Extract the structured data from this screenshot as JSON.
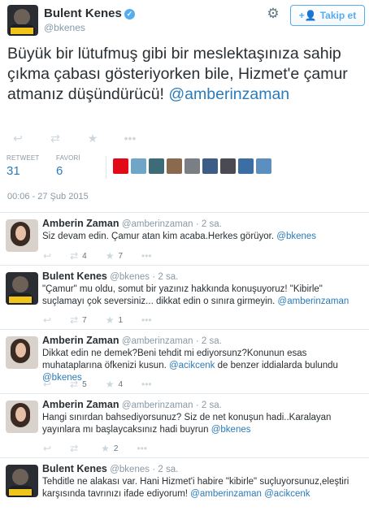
{
  "main": {
    "name": "Bulent Kenes",
    "handle": "@bkenes",
    "follow_label": "Takip et",
    "text": "Büyük bir lütufmuş gibi bir meslektaşınıza sahip çıkma çabası gösteriyorken bile, Hizmet'e çamur atmanız düşündürücü!",
    "mention": "@amberinzaman",
    "retweet_label": "RETWEET",
    "retweet_count": "31",
    "favorite_label": "FAVORİ",
    "favorite_count": "6",
    "timestamp": "00:06 - 27 Şub 2015"
  },
  "colors": {
    "accent": "#55acee",
    "link": "#2b7bb9",
    "muted": "#8899a6",
    "text": "#292f33"
  },
  "icons": {
    "verified": "verified-badge-icon",
    "gear": "gear-icon",
    "follow": "add-user-icon",
    "reply": "reply-icon",
    "retweet": "retweet-icon",
    "favorite": "star-icon",
    "more": "more-icon"
  },
  "replies": [
    {
      "name": "Amberin Zaman",
      "handle": "@amberinzaman",
      "time": "· 2 sa.",
      "text": "Siz devam edin. Çamur atan kim acaba.Herkes görüyor.",
      "mentions": " @bkenes",
      "retweets": "4",
      "favorites": "7"
    },
    {
      "name": "Bulent Kenes",
      "handle": "@bkenes",
      "time": "· 2 sa.",
      "text": "\"Çamur\" mu oldu, somut bir yazınız hakkında konuşuyoruz! \"Kibirle\" suçlamayı çok seversiniz... dikkat edin o sınıra girmeyin.",
      "mentions": " @amberinzaman",
      "retweets": "7",
      "favorites": "1"
    },
    {
      "name": "Amberin Zaman",
      "handle": "@amberinzaman",
      "time": "· 2 sa.",
      "text": "Dikkat edin ne demek?Beni tehdit mi ediyorsunz?Konunun esas muhataplarına öfkenizi kusun.",
      "mention_inline": " @acikcenk",
      "text2": " de benzer iddialarda bulundu",
      "mentions": " @bkenes",
      "retweets": "5",
      "favorites": "4"
    },
    {
      "name": "Amberin Zaman",
      "handle": "@amberinzaman",
      "time": "· 2 sa.",
      "text": "Hangi sınırdan bahsediyorsunuz? Siz de net konuşun hadi..Karalayan yayınlara mı başlaycaksınız hadi buyrun",
      "mentions": " @bkenes",
      "retweets": "",
      "favorites": "2"
    },
    {
      "name": "Bulent Kenes",
      "handle": "@bkenes",
      "time": "· 2 sa.",
      "text": "Tehditle ne alakası var. Hani Hizmet'i habire \"kibirle\" suçluyorsunuz,eleştiri karşısında tavrınızı ifade ediyorum!",
      "mentions": " @amberinzaman",
      "mention2": " @acikcenk",
      "retweets": "",
      "favorites": ""
    }
  ]
}
